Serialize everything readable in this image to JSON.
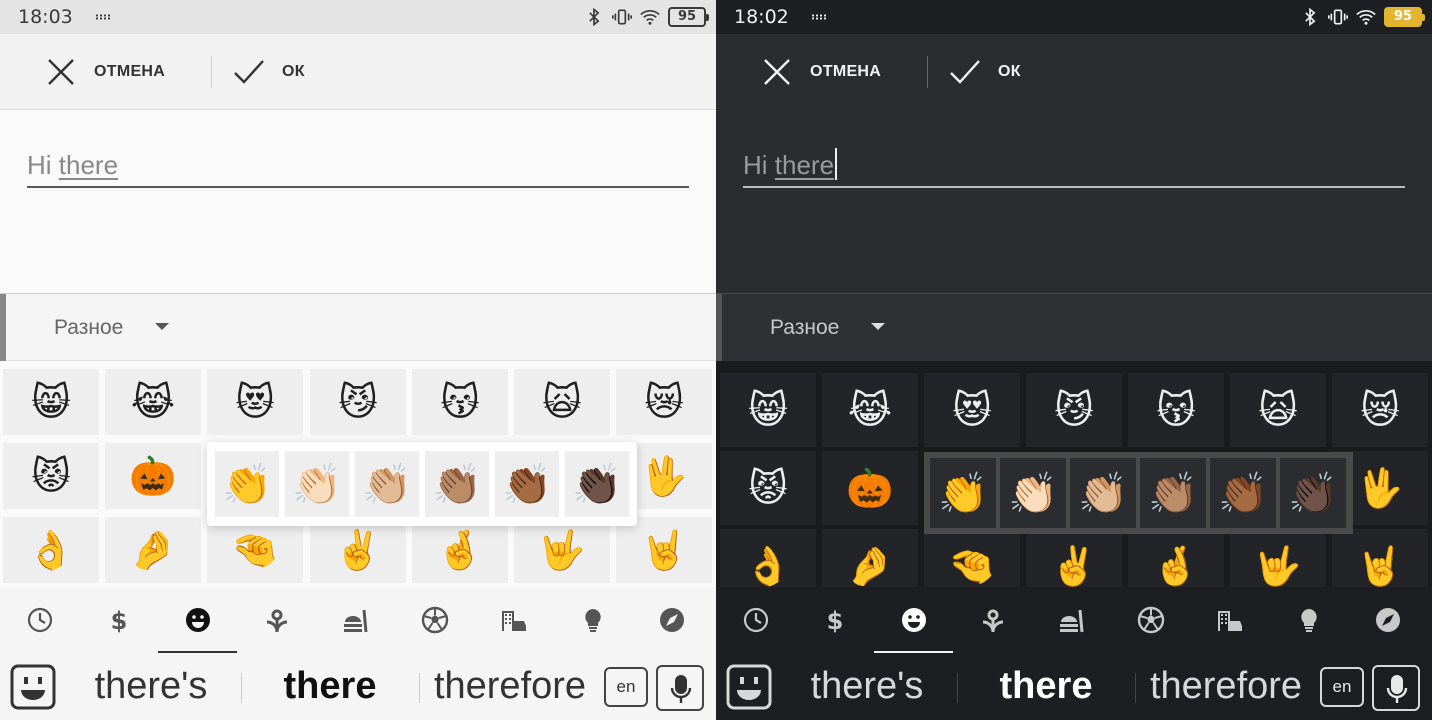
{
  "colors": {
    "light_background": "#fafafa",
    "dark_background": "#2a2c30",
    "dark_battery": "#e2b430"
  },
  "panels": [
    {
      "theme": "light",
      "status_bar": {
        "time": "18:03",
        "battery": "95",
        "icons": [
          "keyboard-indicator-icon",
          "bluetooth-icon",
          "vibrate-icon",
          "wifi-icon",
          "battery-icon"
        ]
      },
      "action_bar": {
        "cancel_label": "ОТМЕНА",
        "ok_label": "ОК"
      },
      "input": {
        "prefix": "Hi ",
        "composing": "there"
      },
      "category": {
        "label": "Разное"
      },
      "emoji_rows": [
        [
          "😸",
          "😹",
          "😻",
          "😼",
          "😽",
          "🙀",
          "😿"
        ],
        [
          "😾",
          "🎃",
          "",
          "",
          "",
          "",
          "🖖"
        ],
        [
          "👌",
          "🤌",
          "🤏",
          "✌️",
          "🤞",
          "🤟",
          "🤘"
        ]
      ],
      "skin_tones": [
        "👏",
        "👏🏻",
        "👏🏼",
        "👏🏽",
        "👏🏾",
        "👏🏿"
      ],
      "tabs": [
        "recent-icon",
        "symbols-icon",
        "smileys-icon",
        "nature-icon",
        "food-icon",
        "activity-icon",
        "places-icon",
        "objects-icon",
        "travel-icon"
      ],
      "active_tab": 2,
      "suggestions": [
        "there's",
        "there",
        "therefore"
      ],
      "language": "en"
    },
    {
      "theme": "dark",
      "status_bar": {
        "time": "18:02",
        "battery": "95",
        "icons": [
          "keyboard-indicator-icon",
          "bluetooth-icon",
          "vibrate-icon",
          "wifi-icon",
          "battery-icon"
        ]
      },
      "action_bar": {
        "cancel_label": "ОТМЕНА",
        "ok_label": "ОК"
      },
      "input": {
        "prefix": "Hi ",
        "composing": "there"
      },
      "category": {
        "label": "Разное"
      },
      "emoji_rows": [
        [
          "😸",
          "😹",
          "😻",
          "😼",
          "😽",
          "🙀",
          "😿"
        ],
        [
          "😾",
          "🎃",
          "",
          "",
          "",
          "",
          "🖖"
        ],
        [
          "👌",
          "🤌",
          "🤏",
          "✌️",
          "🤞",
          "🤟",
          "🤘"
        ]
      ],
      "skin_tones": [
        "👏",
        "👏🏻",
        "👏🏼",
        "👏🏽",
        "👏🏾",
        "👏🏿"
      ],
      "tabs": [
        "recent-icon",
        "symbols-icon",
        "smileys-icon",
        "nature-icon",
        "food-icon",
        "activity-icon",
        "places-icon",
        "objects-icon",
        "travel-icon"
      ],
      "active_tab": 2,
      "suggestions": [
        "there's",
        "there",
        "therefore"
      ],
      "language": "en"
    }
  ]
}
